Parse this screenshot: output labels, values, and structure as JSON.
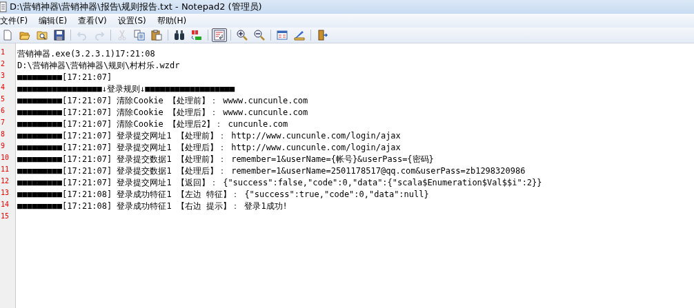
{
  "window": {
    "title": "D:\\营销神器\\营销神器\\报告\\规则报告.txt - Notepad2 (管理员)"
  },
  "menu": [
    "文件(F)",
    "编辑(E)",
    "查看(V)",
    "设置(S)",
    "帮助(H)"
  ],
  "toolbar": [
    {
      "kind": "new",
      "disabled": false,
      "pressed": false
    },
    {
      "kind": "open",
      "disabled": false,
      "pressed": false
    },
    {
      "kind": "browse",
      "disabled": false,
      "pressed": false
    },
    {
      "kind": "save",
      "disabled": false,
      "pressed": false
    },
    {
      "kind": "sep"
    },
    {
      "kind": "undo",
      "disabled": true,
      "pressed": false
    },
    {
      "kind": "redo",
      "disabled": true,
      "pressed": false
    },
    {
      "kind": "sep"
    },
    {
      "kind": "cut",
      "disabled": true,
      "pressed": false
    },
    {
      "kind": "copy",
      "disabled": false,
      "pressed": false
    },
    {
      "kind": "paste",
      "disabled": false,
      "pressed": false
    },
    {
      "kind": "sep"
    },
    {
      "kind": "find",
      "disabled": false,
      "pressed": false
    },
    {
      "kind": "replace",
      "disabled": false,
      "pressed": false
    },
    {
      "kind": "sep"
    },
    {
      "kind": "wrap",
      "disabled": false,
      "pressed": true
    },
    {
      "kind": "sep"
    },
    {
      "kind": "zoomin",
      "disabled": false,
      "pressed": false
    },
    {
      "kind": "zoomout",
      "disabled": false,
      "pressed": false
    },
    {
      "kind": "sep"
    },
    {
      "kind": "view",
      "disabled": false,
      "pressed": false
    },
    {
      "kind": "settings",
      "disabled": false,
      "pressed": false
    },
    {
      "kind": "sep"
    },
    {
      "kind": "exit",
      "disabled": false,
      "pressed": false
    }
  ],
  "lines": [
    {
      "number": "1",
      "text": "营销神器.exe(3.2.3.1)17:21:08"
    },
    {
      "number": "2",
      "text": "D:\\营销神器\\营销神器\\规则\\村村乐.wzdr"
    },
    {
      "number": "3",
      "text": "■■■■■■■■■[17:21:07]"
    },
    {
      "number": "4",
      "text": "■■■■■■■■■■■■■■■■■↓登录规则↓■■■■■■■■■■■■■■■■■■"
    },
    {
      "number": "5",
      "text": "■■■■■■■■■[17:21:07] 清除Cookie 【处理前】： wwww.cuncunle.com"
    },
    {
      "number": "6",
      "text": "■■■■■■■■■[17:21:07] 清除Cookie 【处理后】： wwww.cuncunle.com"
    },
    {
      "number": "7",
      "text": "■■■■■■■■■[17:21:07] 清除Cookie 【处理后2】： cuncunle.com"
    },
    {
      "number": "8",
      "text": "■■■■■■■■■[17:21:07] 登录提交网址1 【处理前】： http://www.cuncunle.com/login/ajax"
    },
    {
      "number": "9",
      "text": "■■■■■■■■■[17:21:07] 登录提交网址1 【处理后】： http://www.cuncunle.com/login/ajax"
    },
    {
      "number": "10",
      "text": "■■■■■■■■■[17:21:07] 登录提交数据1 【处理前】： remember=1&userName={帐号}&userPass={密码}"
    },
    {
      "number": "11",
      "text": "■■■■■■■■■[17:21:07] 登录提交数据1 【处理后】： remember=1&userName=2501178517@qq.com&userPass=zb1298320986"
    },
    {
      "number": "12",
      "text": "■■■■■■■■■[17:21:07] 登录提交网址1 【返回】： {\"success\":false,\"code\":0,\"data\":{\"scala$Enumeration$Val$$i\":2}}"
    },
    {
      "number": "13",
      "text": "■■■■■■■■■[17:21:08] 登录成功特征1 【左边 特征】： {\"success\":true,\"code\":0,\"data\":null}"
    },
    {
      "number": "14",
      "text": "■■■■■■■■■[17:21:08] 登录成功特征1 【右边 提示】： 登录1成功!"
    },
    {
      "number": "15"
    }
  ]
}
